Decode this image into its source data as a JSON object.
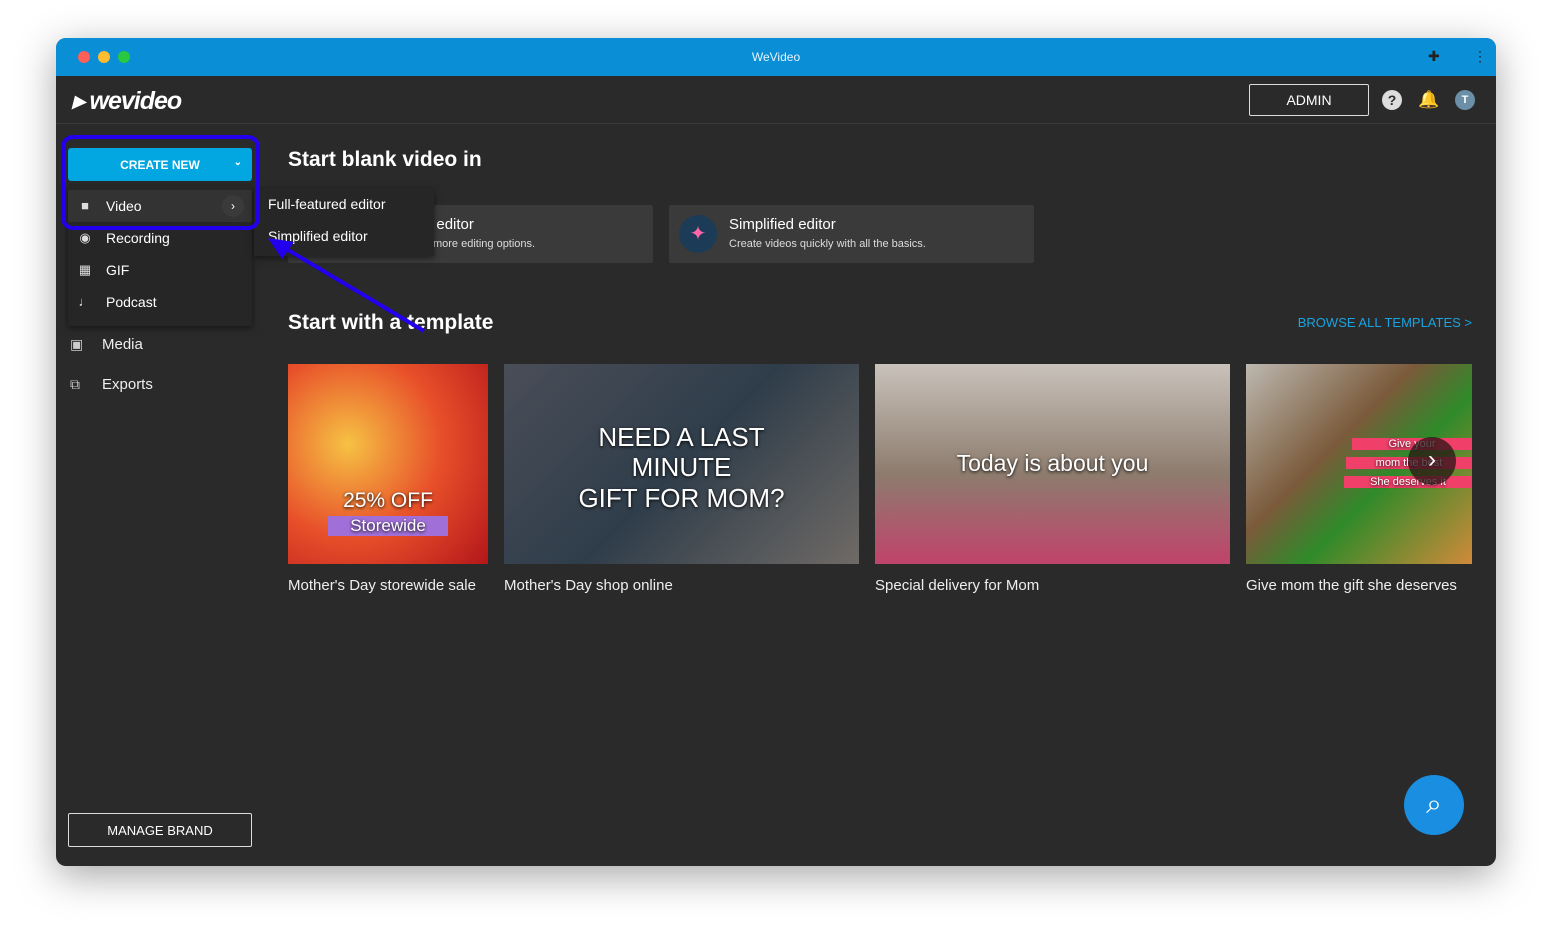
{
  "window": {
    "title": "WeVideo"
  },
  "header": {
    "logo": "wevideo",
    "admin": "ADMIN",
    "avatar": "T"
  },
  "sidebar": {
    "create_new": "CREATE NEW",
    "menu": [
      {
        "label": "Video",
        "icon": "video-camera-icon"
      },
      {
        "label": "Recording",
        "icon": "record-icon"
      },
      {
        "label": "GIF",
        "icon": "gif-icon"
      },
      {
        "label": "Podcast",
        "icon": "music-note-icon"
      }
    ],
    "submenu": [
      "Full-featured editor",
      "Simplified editor"
    ],
    "nav": [
      {
        "label": "Media",
        "icon": "media-icon"
      },
      {
        "label": "Exports",
        "icon": "exports-icon"
      }
    ],
    "manage_brand": "MANAGE BRAND"
  },
  "main": {
    "blank_title": "Start blank video in",
    "editors": [
      {
        "title": "Full-featured editor",
        "desc": "Take control with more editing options."
      },
      {
        "title": "Simplified editor",
        "desc": "Create videos quickly with all the basics."
      }
    ],
    "template_title": "Start with a template",
    "browse": "BROWSE ALL TEMPLATES >",
    "templates": [
      {
        "caption": "Mother's Day storewide sale",
        "overlay": [
          "25% OFF",
          "Storewide"
        ]
      },
      {
        "caption": "Mother's Day shop online",
        "overlay": [
          "NEED A LAST",
          "MINUTE",
          "GIFT FOR MOM?"
        ]
      },
      {
        "caption": "Special delivery for Mom",
        "overlay": [
          "Today is about you"
        ]
      },
      {
        "caption": "Give mom the gift she deserves",
        "overlay": [
          "Give your",
          "mom the best",
          "She deserves it"
        ]
      }
    ]
  },
  "colors": {
    "titlebar": "#0a8ed6",
    "accent": "#02a6e0",
    "annotation": "#2200ee"
  }
}
